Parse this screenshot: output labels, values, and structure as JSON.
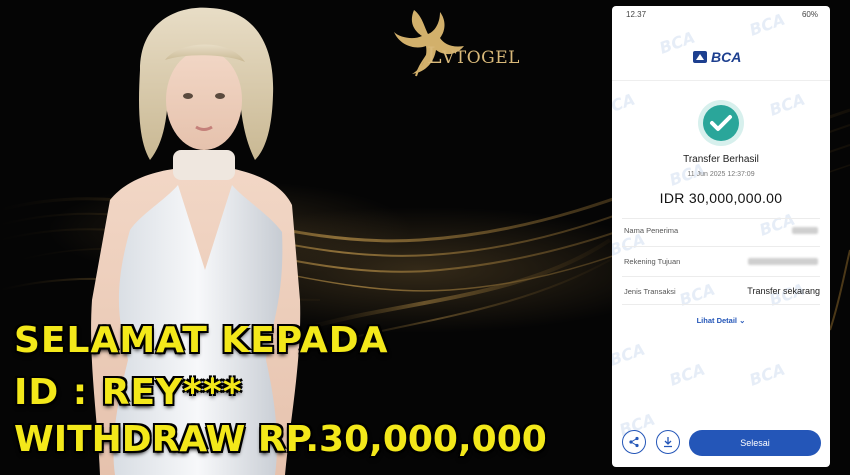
{
  "logo": {
    "text_first": "L",
    "text_rest": "VTOGEL"
  },
  "headline": {
    "line1": "SELAMAT KEPADA",
    "line2": "ID : REY***",
    "line3": "WITHDRAW RP.30,000,000",
    "color": "#f3e81a"
  },
  "receipt": {
    "status_bar": {
      "time": "12.37",
      "battery": "60%"
    },
    "bank": "BCA",
    "status_title": "Transfer Berhasil",
    "timestamp": "11 Jun 2025 12:37:09",
    "amount": "IDR 30,000,000.00",
    "rows": [
      {
        "label": "Nama Penerima",
        "value": ""
      },
      {
        "label": "Rekening Tujuan",
        "value": ""
      },
      {
        "label": "Jenis Transaksi",
        "value": "Transfer sekarang"
      }
    ],
    "detail_link": "Lihat Detail",
    "done_button": "Selesai",
    "icons": [
      "share-icon",
      "download-icon"
    ],
    "accent": "#2456b8",
    "success_color": "#2aa69a"
  }
}
